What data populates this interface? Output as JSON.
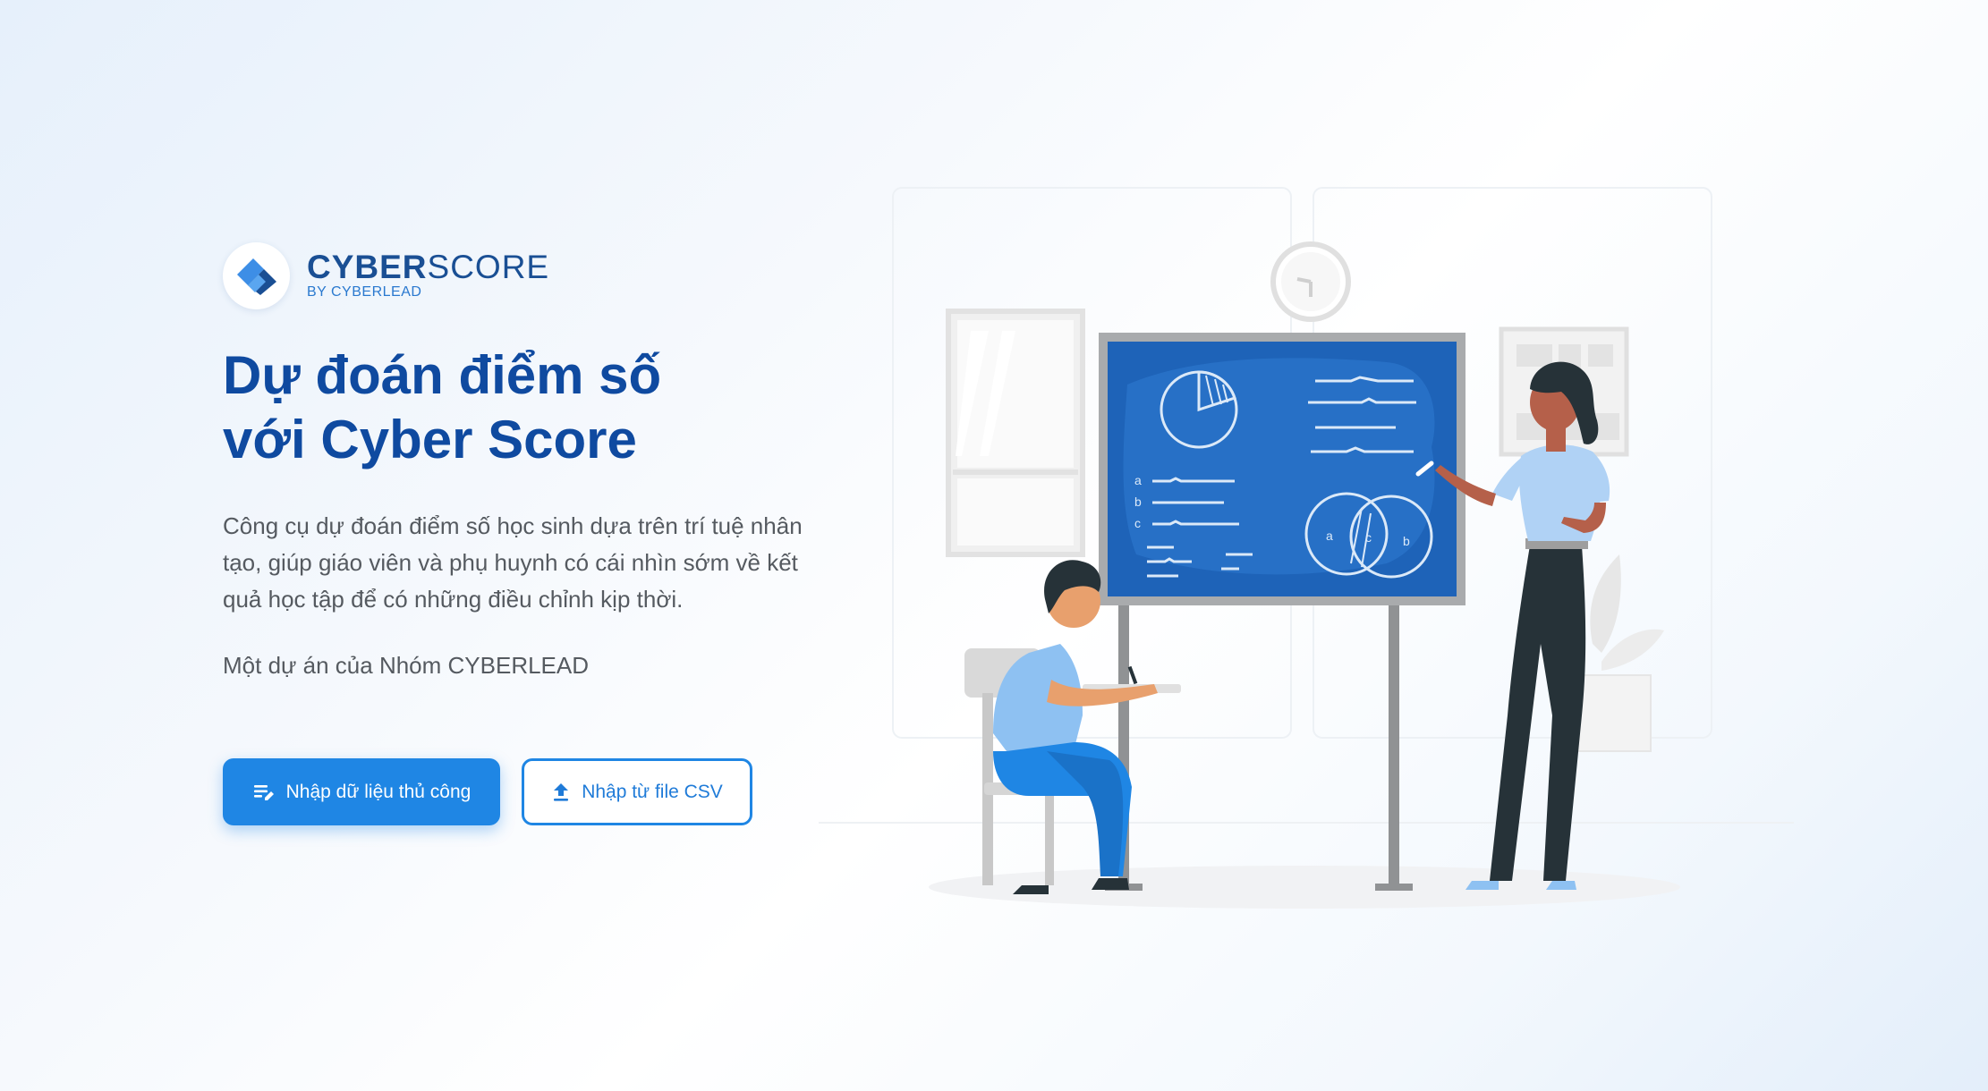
{
  "brand": {
    "name_bold": "CYBER",
    "name_light": "SCORE",
    "subtitle": "BY CYBERLEAD"
  },
  "hero": {
    "title_line1": "Dự đoán điểm số",
    "title_line2": "với Cyber Score",
    "description": "Công cụ dự đoán điểm số học sinh dựa trên trí tuệ nhân tạo, giúp giáo viên và phụ huynh có cái nhìn sớm về kết quả học tập để có những điều chỉnh kịp thời.",
    "credit": "Một dự án của Nhóm CYBERLEAD"
  },
  "actions": {
    "manual_label": "Nhập dữ liệu thủ công",
    "manual_icon": "edit-list-icon",
    "csv_label": "Nhập từ file CSV",
    "csv_icon": "upload-icon"
  },
  "illustration": {
    "board_letters": [
      "a",
      "b",
      "c"
    ],
    "venn_labels": [
      "a",
      "c",
      "b"
    ]
  },
  "colors": {
    "primary": "#1f86e4",
    "heading": "#0f4aa0",
    "brand": "#1a4f94",
    "board": "#1e63b8"
  }
}
